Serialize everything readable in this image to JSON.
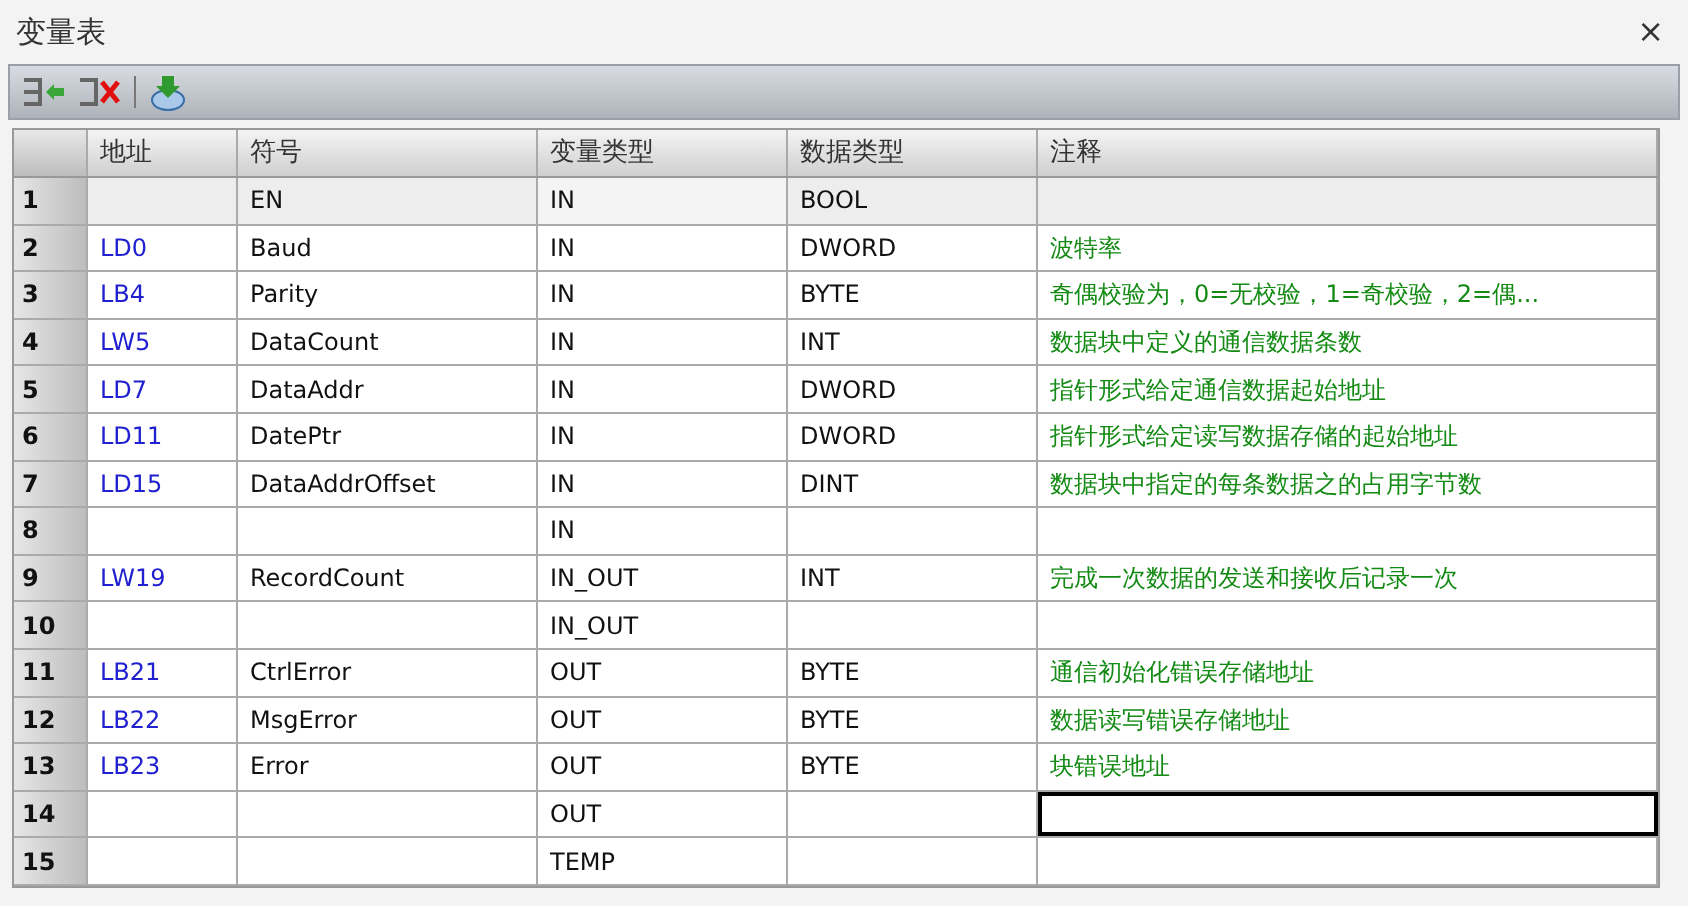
{
  "window": {
    "title": "变量表",
    "close": "×"
  },
  "table": {
    "columns": [
      "地址",
      "符号",
      "变量类型",
      "数据类型",
      "注释"
    ],
    "rows": [
      {
        "n": "1",
        "address": "",
        "symbol": "EN",
        "var_type": "IN",
        "data_type": "BOOL",
        "comment": "",
        "readonly": true,
        "selected": false
      },
      {
        "n": "2",
        "address": "LD0",
        "symbol": "Baud",
        "var_type": "IN",
        "data_type": "DWORD",
        "comment": "波特率",
        "readonly": false,
        "selected": false
      },
      {
        "n": "3",
        "address": "LB4",
        "symbol": "Parity",
        "var_type": "IN",
        "data_type": "BYTE",
        "comment": "奇偶校验为，0=无校验，1=奇校验，2=偶...",
        "readonly": false,
        "selected": false
      },
      {
        "n": "4",
        "address": "LW5",
        "symbol": "DataCount",
        "var_type": "IN",
        "data_type": "INT",
        "comment": "数据块中定义的通信数据条数",
        "readonly": false,
        "selected": false
      },
      {
        "n": "5",
        "address": "LD7",
        "symbol": "DataAddr",
        "var_type": "IN",
        "data_type": "DWORD",
        "comment": "指针形式给定通信数据起始地址",
        "readonly": false,
        "selected": false
      },
      {
        "n": "6",
        "address": "LD11",
        "symbol": "DatePtr",
        "var_type": "IN",
        "data_type": "DWORD",
        "comment": "指针形式给定读写数据存储的起始地址",
        "readonly": false,
        "selected": false
      },
      {
        "n": "7",
        "address": "LD15",
        "symbol": "DataAddrOffset",
        "var_type": "IN",
        "data_type": "DINT",
        "comment": "数据块中指定的每条数据之的占用字节数",
        "readonly": false,
        "selected": false
      },
      {
        "n": "8",
        "address": "",
        "symbol": "",
        "var_type": "IN",
        "data_type": "",
        "comment": "",
        "readonly": false,
        "selected": false
      },
      {
        "n": "9",
        "address": "LW19",
        "symbol": "RecordCount",
        "var_type": "IN_OUT",
        "data_type": "INT",
        "comment": "完成一次数据的发送和接收后记录一次",
        "readonly": false,
        "selected": false
      },
      {
        "n": "10",
        "address": "",
        "symbol": "",
        "var_type": "IN_OUT",
        "data_type": "",
        "comment": "",
        "readonly": false,
        "selected": false
      },
      {
        "n": "11",
        "address": "LB21",
        "symbol": "CtrlError",
        "var_type": "OUT",
        "data_type": "BYTE",
        "comment": "通信初始化错误存储地址",
        "readonly": false,
        "selected": false
      },
      {
        "n": "12",
        "address": "LB22",
        "symbol": "MsgError",
        "var_type": "OUT",
        "data_type": "BYTE",
        "comment": "数据读写错误存储地址",
        "readonly": false,
        "selected": false
      },
      {
        "n": "13",
        "address": "LB23",
        "symbol": "Error",
        "var_type": "OUT",
        "data_type": "BYTE",
        "comment": "块错误地址",
        "readonly": false,
        "selected": false
      },
      {
        "n": "14",
        "address": "",
        "symbol": "",
        "var_type": "OUT",
        "data_type": "",
        "comment": "",
        "readonly": false,
        "selected": true
      },
      {
        "n": "15",
        "address": "",
        "symbol": "",
        "var_type": "TEMP",
        "data_type": "",
        "comment": "",
        "readonly": false,
        "selected": false
      }
    ]
  }
}
